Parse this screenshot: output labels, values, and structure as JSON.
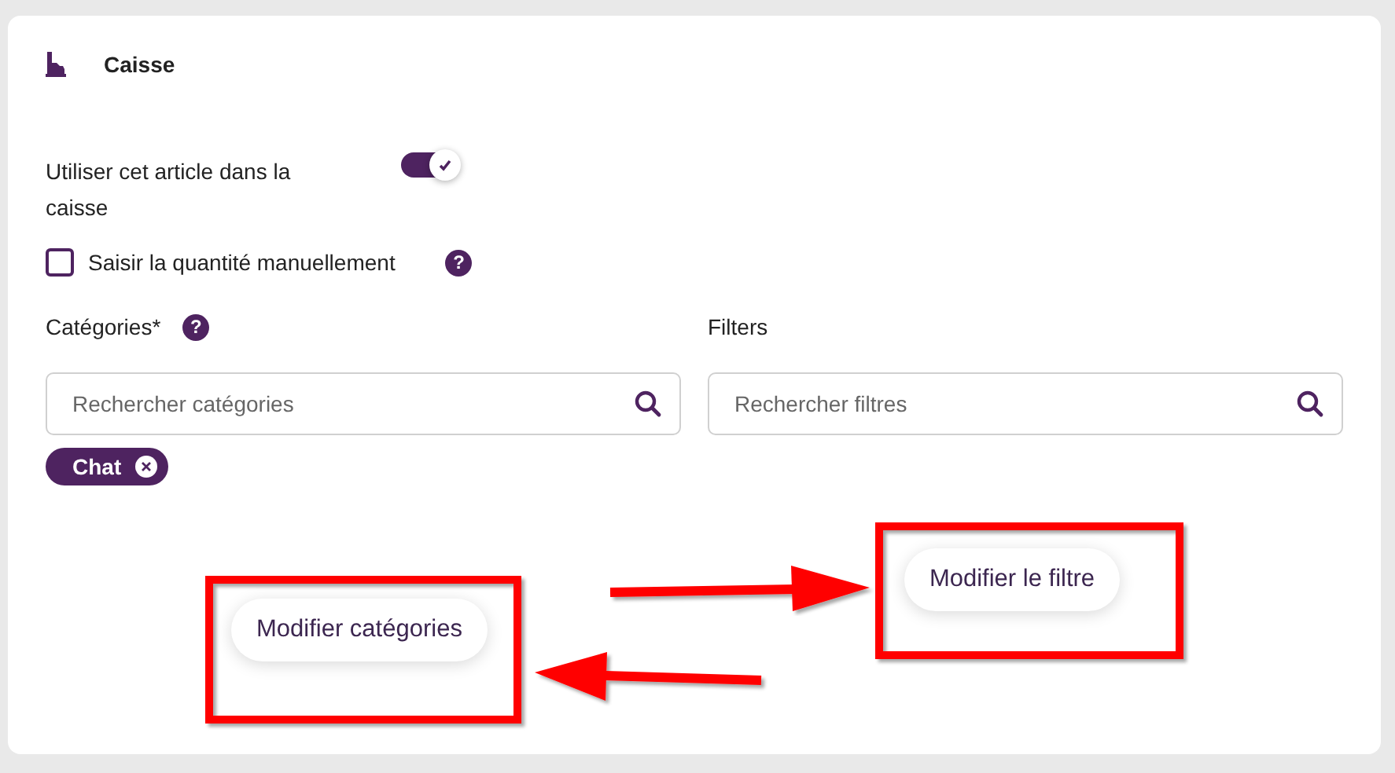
{
  "section": {
    "title": "Caisse"
  },
  "toggle": {
    "label": "Utiliser cet article dans la caisse",
    "on": true
  },
  "checkbox": {
    "label": "Saisir la quantité manuellement",
    "checked": false,
    "help": "?"
  },
  "categories": {
    "label": "Catégories*",
    "help": "?",
    "placeholder": "Rechercher catégories",
    "chips": [
      {
        "label": "Chat"
      }
    ]
  },
  "filters": {
    "label": "Filters",
    "placeholder": "Rechercher filtres"
  },
  "buttons": [
    {
      "label": "Modifier catégories"
    },
    {
      "label": "Modifier le filtre"
    }
  ]
}
